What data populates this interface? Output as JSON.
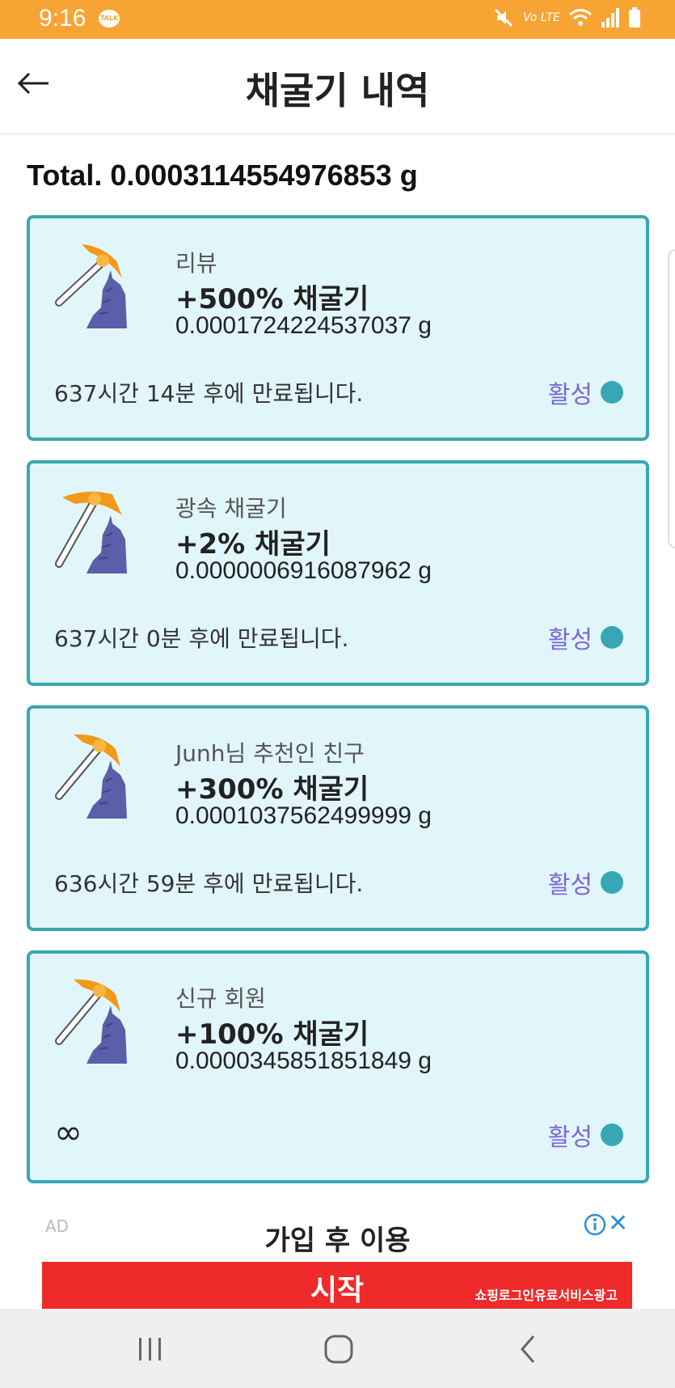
{
  "status_bar": {
    "time": "9:16",
    "talk_badge": "TALK",
    "volte_label": "Vo LTE",
    "icons": [
      "kakaotalk-icon",
      "mute-icon",
      "volte-icon",
      "wifi-icon",
      "signal-icon",
      "battery-icon"
    ]
  },
  "app_bar": {
    "title": "채굴기 내역",
    "back_icon": "arrow-left-icon"
  },
  "total": "Total. 0.0003114554976853 g",
  "miners": [
    {
      "source": "리뷰",
      "boost": "+500% 채굴기",
      "amount": "0.0001724224537037 g",
      "expiry": "637시간 14분 후에 만료됩니다.",
      "status": "활성",
      "icon": "pickaxe-rock-icon"
    },
    {
      "source": "광속 채굴기",
      "boost": "+2% 채굴기",
      "amount": "0.0000006916087962 g",
      "expiry": "637시간 0분 후에 만료됩니다.",
      "status": "활성",
      "icon": "pickaxe-rock-icon"
    },
    {
      "source": "Junh님 추천인 친구",
      "boost": "+300% 채굴기",
      "amount": "0.0001037562499999 g",
      "expiry": "636시간 59분 후에 만료됩니다.",
      "status": "활성",
      "icon": "pickaxe-rock-icon"
    },
    {
      "source": "신규 회원",
      "boost": "+100% 채굴기",
      "amount": "0.0000345851851849 g",
      "expiry": "∞",
      "status": "활성",
      "icon": "pickaxe-rock-icon"
    }
  ],
  "ad": {
    "badge": "AD",
    "headline": "가입 후 이용",
    "cta": "시작",
    "disclaimer": "쇼핑로그인유료서비스광고",
    "info_icon": "info-icon",
    "close_icon": "close-icon",
    "close_glyph": "✕"
  },
  "nav_bar": {
    "icons": [
      "recent-apps-icon",
      "home-icon",
      "back-nav-icon"
    ]
  },
  "colors": {
    "status_bar": "#f8a434",
    "card_bg": "#e1f6fa",
    "card_border": "#37a8b3",
    "status_label": "#7b68d6",
    "status_dot": "#37a8b3",
    "ad_banner": "#ee2a2a"
  }
}
